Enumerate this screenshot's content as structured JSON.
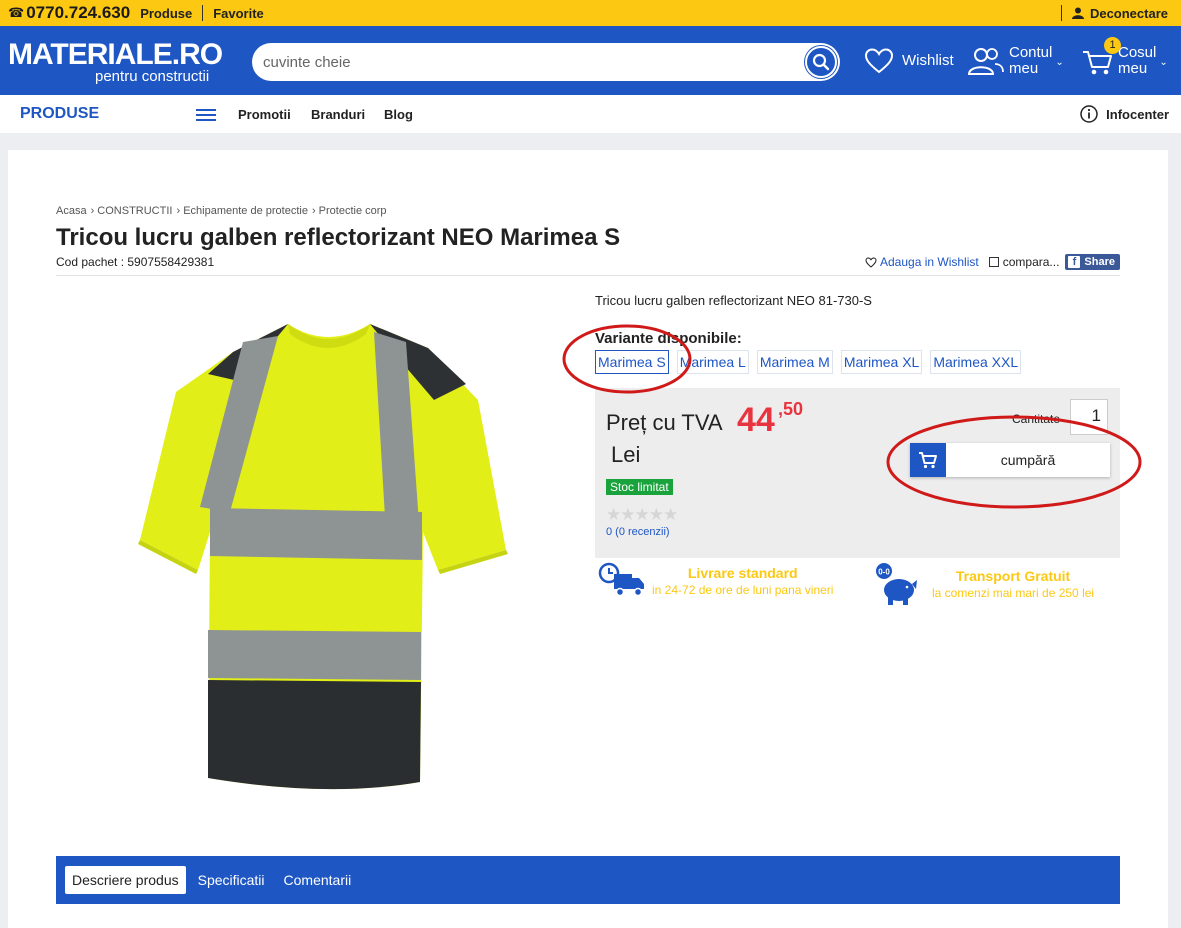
{
  "topbar": {
    "phone": "0770.724.630",
    "links": [
      "Produse",
      "Favorite"
    ],
    "logout": "Deconectare"
  },
  "header": {
    "logo_main": "MATERIALE.RO",
    "logo_sub": "pentru constructii",
    "search_placeholder": "cuvinte cheie",
    "wishlist": "Wishlist",
    "account_line1": "Contul",
    "account_line2": "meu",
    "cart_line1": "Cosul",
    "cart_line2": "meu",
    "cart_count": "1"
  },
  "nav": {
    "produse": "PRODUSE",
    "links": [
      "Promotii",
      "Branduri",
      "Blog"
    ],
    "infocenter": "Infocenter"
  },
  "breadcrumb": [
    "Acasa",
    "› CONSTRUCTII",
    "› Echipamente de protectie",
    "› Protectie corp"
  ],
  "product": {
    "title": "Tricou lucru galben reflectorizant NEO Marimea S",
    "cod": "Cod pachet : 5907558429381",
    "add_wishlist": "Adauga in Wishlist",
    "compare": "compara...",
    "share": "Share",
    "short_desc": "Tricou lucru galben reflectorizant NEO 81-730-S",
    "variants_title": "Variante disponibile:",
    "variants": [
      "Marimea S",
      "Marimea L",
      "Marimea M",
      "Marimea XL",
      "Marimea XXL"
    ],
    "price_label": "Preț cu TVA",
    "price_int": "44",
    "price_dec": ",50",
    "currency": "Lei",
    "stock": "Stoc limitat",
    "stars": "★★★★★",
    "rating": 0,
    "reviews": "0 (0 recenzii)",
    "qty_label": "Cantitate",
    "qty": "1",
    "buy": "cumpără"
  },
  "shipping": [
    {
      "title": "Livrare standard",
      "sub": "in 24-72 de ore de luni pana vineri",
      "icon": "delivery-truck-icon"
    },
    {
      "title": "Transport Gratuit",
      "sub": "la comenzi mai mari de 250 lei",
      "icon": "piggy-bank-icon",
      "badge": "0-0"
    }
  ],
  "tabs": [
    "Descriere produs",
    "Specificatii",
    "Comentarii"
  ],
  "colors": {
    "brand_blue": "#1e56c4",
    "topbar_yellow": "#fdc812",
    "price_red": "#e8343f",
    "stock_green": "#1aa33c",
    "annotation_red": "#d01a1a"
  }
}
